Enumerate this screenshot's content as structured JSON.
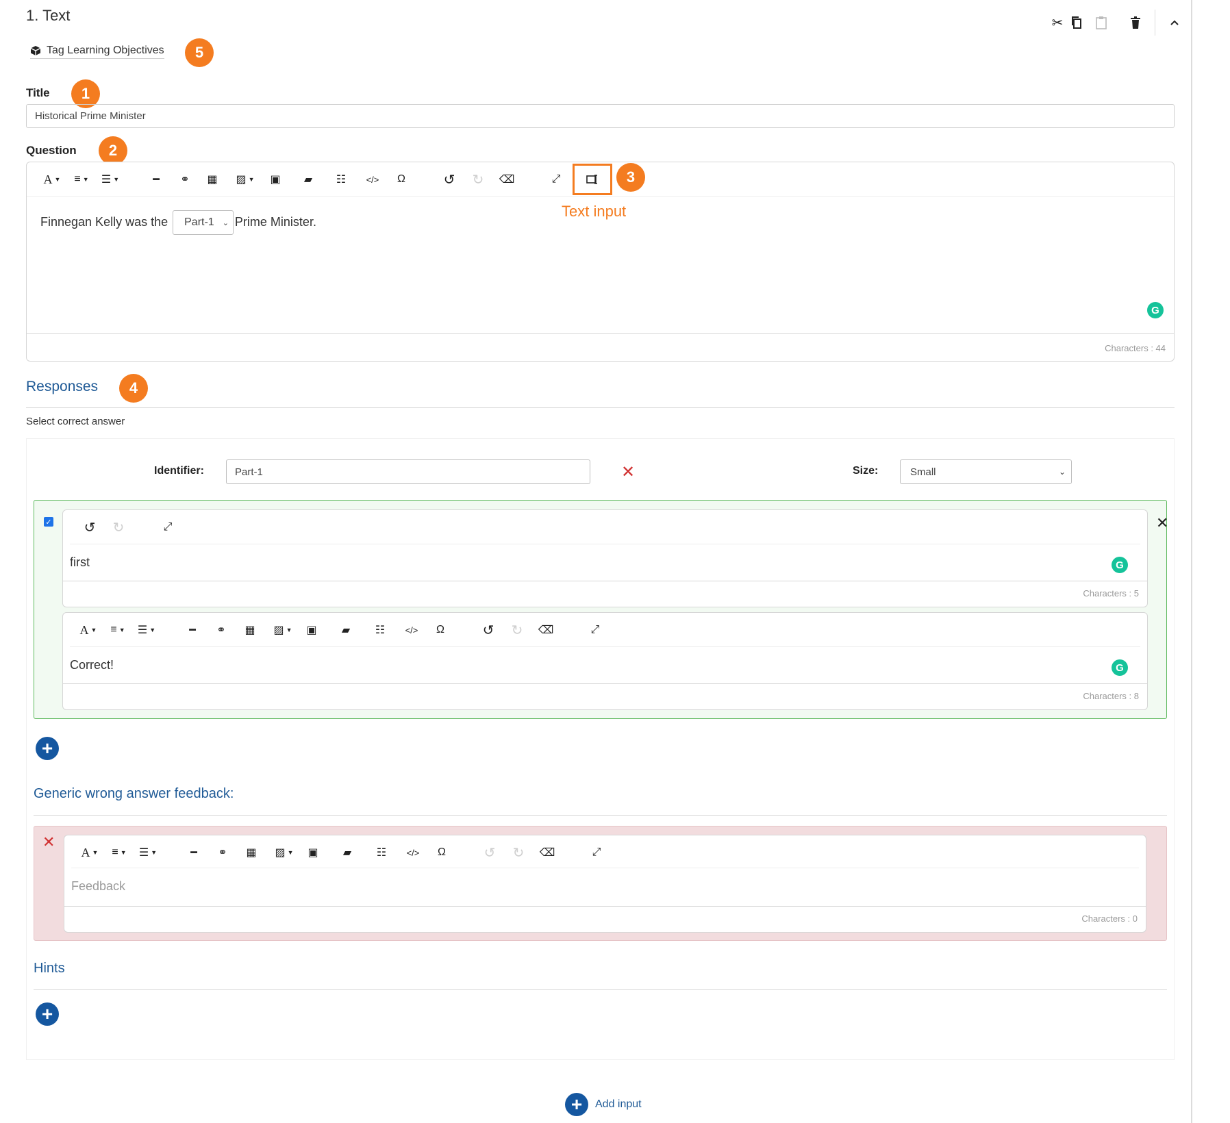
{
  "header": {
    "title": "1. Text",
    "icons": [
      "scissors-icon",
      "copy-icon",
      "paste-icon",
      "trash-icon",
      "chevron-up-icon"
    ]
  },
  "tag_link": {
    "label": "Tag Learning Objectives"
  },
  "badges": {
    "b1": "1",
    "b2": "2",
    "b3": "3",
    "b4": "4",
    "b5": "5"
  },
  "title_field": {
    "label": "Title",
    "value": "Historical Prime Minister"
  },
  "question": {
    "label": "Question",
    "text_before": "Finnegan Kelly was the",
    "dropdown_value": "Part-1",
    "text_after": "Prime Minister.",
    "characters": "Characters : 44"
  },
  "callout": {
    "label": "Text input",
    "color": "#f47c20"
  },
  "responses": {
    "heading": "Responses",
    "instruction": "Select correct answer",
    "identifier_label": "Identifier:",
    "identifier_value": "Part-1",
    "size_label": "Size:",
    "size_value": "Small",
    "answer": {
      "text": "first",
      "characters": "Characters : 5",
      "checked": true
    },
    "feedback": {
      "text": "Correct!",
      "characters": "Characters : 8"
    }
  },
  "generic_feedback": {
    "heading": "Generic wrong answer feedback:",
    "placeholder": "Feedback",
    "characters": "Characters : 0"
  },
  "hints": {
    "heading": "Hints"
  },
  "add_input": {
    "label": "Add input"
  },
  "colors": {
    "accent_orange": "#f47c20",
    "link_blue": "#1f5a96",
    "button_blue": "#1557a0",
    "correct_bg": "#f2faf2",
    "correct_border": "#5cb85c",
    "wrong_bg": "#f2dcde",
    "grammarly": "#15c39a"
  }
}
